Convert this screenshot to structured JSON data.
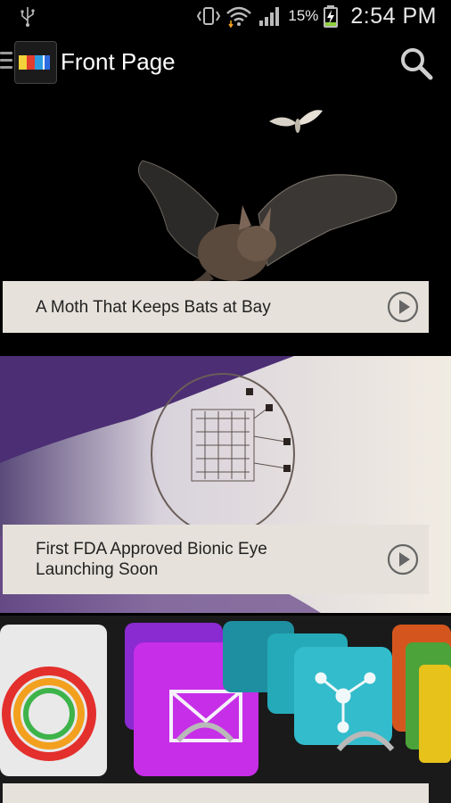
{
  "status_bar": {
    "battery_percent": "15%",
    "time": "2:54 PM",
    "icons": [
      "usb-icon",
      "vibrate-icon",
      "wifi-icon",
      "signal-icon",
      "battery-charging-icon"
    ]
  },
  "action_bar": {
    "title": "Front Page",
    "logo_icon": "app-logo-icon",
    "menu_icon": "menu-icon",
    "search_icon": "search-icon"
  },
  "stories": [
    {
      "title": "A Moth That Keeps Bats at Bay",
      "action_icon": "play-icon"
    },
    {
      "title": "First FDA Approved Bionic Eye Launching Soon",
      "action_icon": "play-icon"
    },
    {
      "title": "",
      "action_icon": "play-icon"
    }
  ],
  "colors": {
    "background": "#000000",
    "caption_bg": "#e6e2db",
    "caption_text": "#222222"
  }
}
